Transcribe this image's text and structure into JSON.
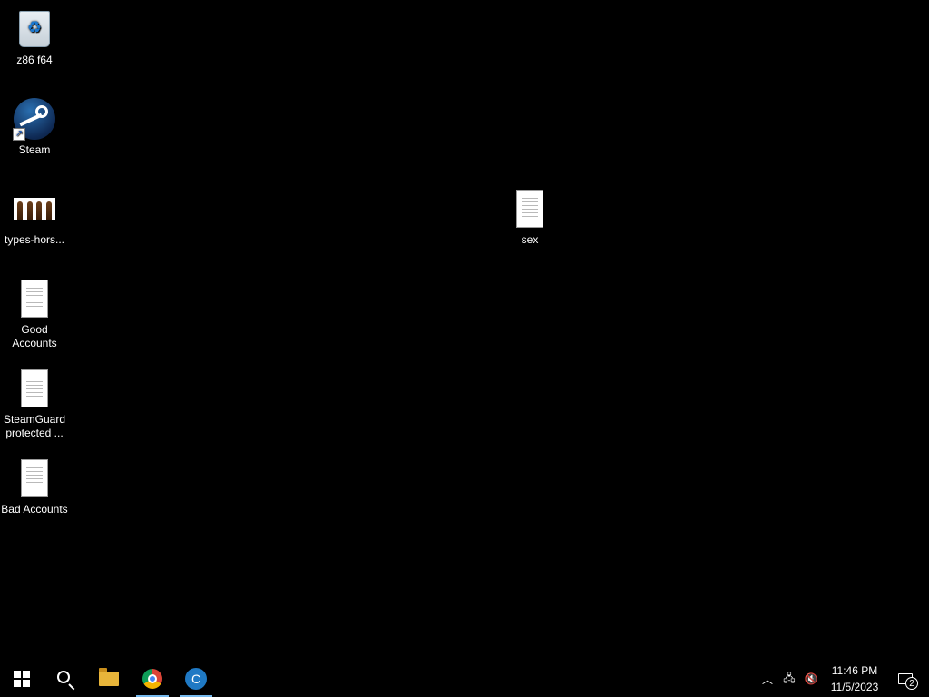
{
  "desktop": {
    "icons": [
      {
        "label": "z86 f64",
        "icon": "recycle-bin-icon"
      },
      {
        "label": "Steam",
        "icon": "steam-icon"
      },
      {
        "label": "types-hors...",
        "icon": "image-thumbnail-icon"
      },
      {
        "label": "Good Accounts",
        "icon": "text-document-icon"
      },
      {
        "label": "SteamGuard protected ...",
        "icon": "text-document-icon"
      },
      {
        "label": "Bad Accounts",
        "icon": "text-document-icon"
      },
      {
        "label": "sex",
        "icon": "text-document-icon"
      }
    ]
  },
  "taskbar": {
    "pinned": [
      {
        "name": "Start",
        "icon": "windows-logo-icon"
      },
      {
        "name": "Search",
        "icon": "search-icon"
      },
      {
        "name": "File Explorer",
        "icon": "folder-icon"
      },
      {
        "name": "Google Chrome",
        "icon": "chrome-icon",
        "active": true
      },
      {
        "name": "CCleaner",
        "icon": "ccleaner-icon",
        "active": true
      }
    ],
    "tray": {
      "time": "11:46 PM",
      "date": "11/5/2023",
      "notification_count": "2"
    }
  },
  "colors": {
    "background": "#000000",
    "taskbar": "#000000",
    "active_indicator": "#76b9ed"
  }
}
